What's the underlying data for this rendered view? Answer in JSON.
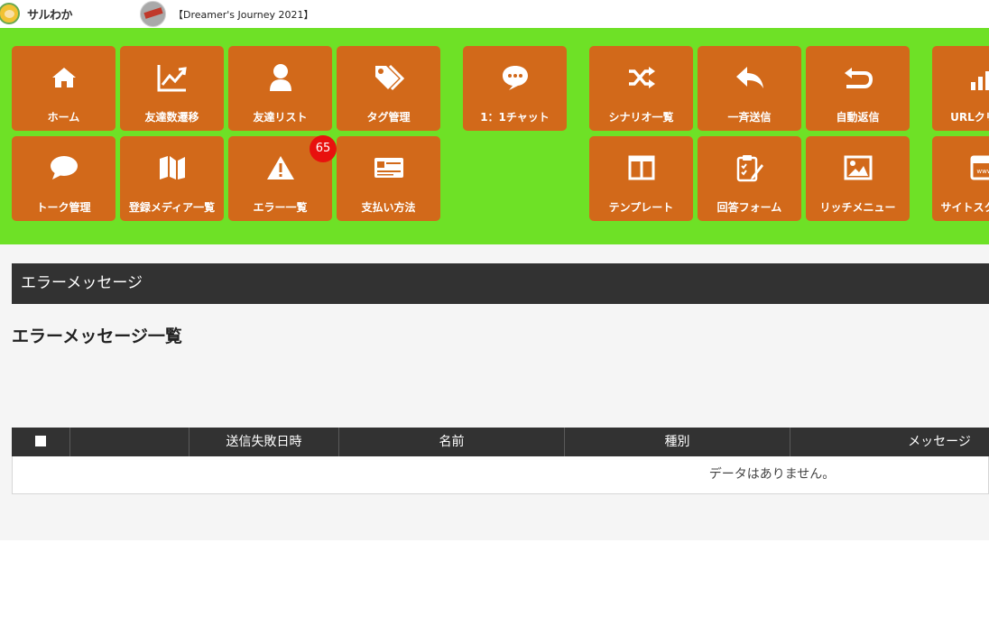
{
  "app": {
    "logo_text": "サルわか",
    "account_name": "【Dreamer's Journey 2021】"
  },
  "menu": {
    "background": "#6ee126",
    "tile_color": "#d2691a",
    "tiles": [
      {
        "label": "ホーム",
        "icon": "home-icon"
      },
      {
        "label": "友達数遷移",
        "icon": "line-chart-icon"
      },
      {
        "label": "友達リスト",
        "icon": "user-icon"
      },
      {
        "label": "タグ管理",
        "icon": "tags-icon"
      },
      {
        "label": "1：1チャット",
        "icon": "chat-bubble-icon"
      },
      {
        "label": "シナリオ一覧",
        "icon": "shuffle-icon"
      },
      {
        "label": "一斉送信",
        "icon": "reply-icon"
      },
      {
        "label": "自動返信",
        "icon": "return-icon"
      },
      {
        "label": "URLクリック",
        "icon": "bar-chart-icon"
      },
      {
        "label": "トーク管理",
        "icon": "comment-icon"
      },
      {
        "label": "登録メディア一覧",
        "icon": "map-icon"
      },
      {
        "label": "エラー一覧",
        "icon": "warning-icon",
        "badge": "65"
      },
      {
        "label": "支払い方法",
        "icon": "payment-card-icon"
      },
      {
        "label": "テンプレート",
        "icon": "columns-icon"
      },
      {
        "label": "回答フォーム",
        "icon": "clipboard-edit-icon"
      },
      {
        "label": "リッチメニュー",
        "icon": "image-icon"
      },
      {
        "label": "サイトスクリプト",
        "icon": "browser-window-icon"
      }
    ]
  },
  "section": {
    "header": "エラーメッセージ",
    "title": "エラーメッセージ一覧"
  },
  "table": {
    "columns": [
      "",
      "",
      "送信失敗日時",
      "名前",
      "種別",
      "メッセージ"
    ],
    "empty_text": "データはありません。"
  }
}
